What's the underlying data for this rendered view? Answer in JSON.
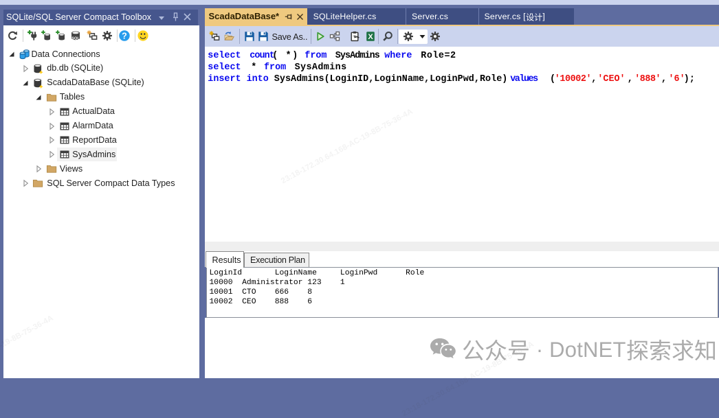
{
  "toolbox": {
    "title": "SQLite/SQL Server Compact Toolbox",
    "titlebar_icons": [
      "window-menu-icon",
      "pin-icon",
      "close-icon"
    ],
    "toolbar": [
      "refresh",
      "sep",
      "add-connection",
      "add-database",
      "add-ce-database",
      "sqlserver-database",
      "new-window",
      "settings",
      "sep",
      "help",
      "sep",
      "feedback-smiley"
    ],
    "tree": [
      {
        "label": "Data Connections",
        "level": 0,
        "arrow": "expanded",
        "icon": "data-connections"
      },
      {
        "label": "db.db (SQLite)",
        "level": 1,
        "arrow": "collapsed",
        "icon": "database"
      },
      {
        "label": "ScadaDataBase (SQLite)",
        "level": 1,
        "arrow": "expanded",
        "icon": "database"
      },
      {
        "label": "Tables",
        "level": 2,
        "arrow": "expanded",
        "icon": "folder"
      },
      {
        "label": "ActualData",
        "level": 3,
        "arrow": "collapsed",
        "icon": "table"
      },
      {
        "label": "AlarmData",
        "level": 3,
        "arrow": "collapsed",
        "icon": "table"
      },
      {
        "label": "ReportData",
        "level": 3,
        "arrow": "collapsed",
        "icon": "table"
      },
      {
        "label": "SysAdmins",
        "level": 3,
        "arrow": "collapsed",
        "icon": "table",
        "selected": true
      },
      {
        "label": "Views",
        "level": 2,
        "arrow": "collapsed",
        "icon": "folder"
      },
      {
        "label": "SQL Server Compact Data Types",
        "level": 1,
        "arrow": "collapsed",
        "icon": "folder"
      }
    ]
  },
  "document_tabs": [
    {
      "label": "ScadaDataBase*",
      "active": true,
      "icons": [
        "pin-icon",
        "close-icon"
      ]
    },
    {
      "label": "SQLiteHelper.cs",
      "active": false
    },
    {
      "label": "Server.cs",
      "active": false
    },
    {
      "label": "Server.cs [设计]",
      "active": false
    }
  ],
  "sql_toolbar": {
    "icons": [
      "new-query",
      "open",
      "sep",
      "save",
      "save-as",
      "sep-after-label",
      "execute",
      "execution-plan",
      "script",
      "export-excel",
      "sep",
      "search",
      "sep",
      "options-dropdown",
      "options"
    ],
    "save_as_label": "Save As.."
  },
  "sql_editor": {
    "lines": [
      [
        {
          "t": "select",
          "c": "kw"
        },
        {
          "t": "count",
          "c": "kw"
        },
        {
          "t": "(",
          "c": "pl"
        },
        {
          "t": "*",
          "c": "pl"
        },
        {
          "t": ")",
          "c": "pl"
        },
        {
          "t": "from",
          "c": "kw"
        },
        {
          "t": "SysAdmins",
          "c": "id"
        },
        {
          "t": "where",
          "c": "kw"
        },
        {
          "t": "Role=2",
          "c": "id"
        }
      ],
      [
        {
          "t": "select",
          "c": "kw"
        },
        {
          "t": "*",
          "c": "pl"
        },
        {
          "t": "from",
          "c": "kw"
        },
        {
          "t": "SysAdmins",
          "c": "id"
        }
      ],
      [
        {
          "t": "insert",
          "c": "kw"
        },
        {
          "t": "into",
          "c": "kw"
        },
        {
          "t": "SysAdmins(LoginID,LoginName,LoginPwd,Role)",
          "c": "id"
        },
        {
          "t": "values",
          "c": "kw"
        },
        {
          "t": "(",
          "c": "pl"
        },
        {
          "t": "'10002'",
          "c": "str"
        },
        {
          "t": ",",
          "c": "pl"
        },
        {
          "t": "'CEO'",
          "c": "str"
        },
        {
          "t": ",",
          "c": "pl"
        },
        {
          "t": "'888'",
          "c": "str"
        },
        {
          "t": ",",
          "c": "pl"
        },
        {
          "t": "'6'",
          "c": "str"
        },
        {
          "t": ");",
          "c": "pl"
        }
      ]
    ]
  },
  "results_panel": {
    "tabs": [
      {
        "label": "Results",
        "active": true
      },
      {
        "label": "Execution Plan",
        "active": false
      }
    ],
    "grid": {
      "header": [
        "LoginId",
        "LoginName",
        "LoginPwd",
        "Role"
      ],
      "rows": [
        [
          "10000",
          "Administrator",
          "123",
          "1"
        ],
        [
          "10001",
          "CTO",
          "666",
          "8"
        ],
        [
          "10002",
          "CEO",
          "888",
          "6"
        ]
      ]
    }
  },
  "watermarks": {
    "diagonal_text": "23:18-172.30.64.168-AC-19-8B-75-36-4A",
    "account_text": "公众号 · DotNET探索求知",
    "account_icon": "wechat-icon"
  },
  "colors": {
    "accent_tab": "#EFC97F",
    "titlebar": "#46568D",
    "frame": "#5E6CA0",
    "toolbar_bg": "#CBD4EE",
    "keyword_blue": "#0A0AF0",
    "string_red": "#ED1111"
  }
}
